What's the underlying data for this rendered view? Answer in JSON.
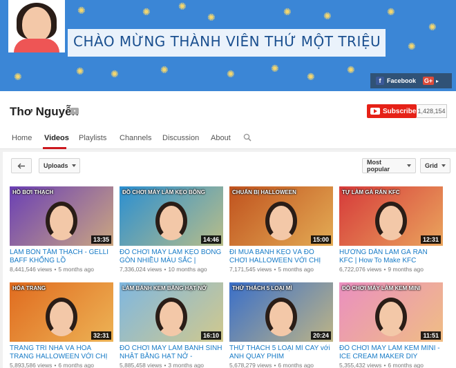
{
  "banner": {
    "tagline": "CHÀO MỪNG THÀNH VIÊN THỨ MỘT TRIỆU",
    "links": [
      {
        "label": "Facebook",
        "icon": "facebook-icon"
      },
      {
        "label": "",
        "icon": "google-plus-icon"
      }
    ]
  },
  "channel": {
    "name": "Thơ Nguyễn",
    "subscribe_label": "Subscribe",
    "subscriber_count": "1,428,154"
  },
  "tabs": [
    {
      "label": "Home",
      "active": false
    },
    {
      "label": "Videos",
      "active": true
    },
    {
      "label": "Playlists",
      "active": false
    },
    {
      "label": "Channels",
      "active": false
    },
    {
      "label": "Discussion",
      "active": false
    },
    {
      "label": "About",
      "active": false
    }
  ],
  "toolbar": {
    "uploads_label": "Uploads",
    "sort_label": "Most popular",
    "view_label": "Grid"
  },
  "videos": [
    {
      "title": "LÀM BỒN TẮM THẠCH - GELLI BAFF KHỔNG LỒ",
      "views": "8,441,546 views",
      "age": "5 months ago",
      "duration": "13:35",
      "thumb_caption": "HỒ BƠI THẠCH",
      "color": "#6a3fb5"
    },
    {
      "title": "ĐỒ CHƠI MÁY LÀM KẸO BÔNG GÒN NHIỀU MÀU SẮC | CANDY...",
      "views": "7,336,024 views",
      "age": "10 months ago",
      "duration": "14:46",
      "thumb_caption": "ĐỒ CHƠI MÁY LÀM KẸO BÔNG",
      "color": "#2b8fd1"
    },
    {
      "title": "ĐI MUA BÁNH KẸO VÀ ĐỒ CHƠI HALLOWEEN VỚI CHỊ THƠ...",
      "views": "7,171,545 views",
      "age": "5 months ago",
      "duration": "15:00",
      "thumb_caption": "CHUẨN BỊ HALLOWEEN",
      "color": "#c0521e"
    },
    {
      "title": "HƯỚNG DẪN LÀM GÀ RÁN KFC | How To Make KFC Chicken",
      "views": "6,722,076 views",
      "age": "9 months ago",
      "duration": "12:31",
      "thumb_caption": "TỰ LÀM GÀ RÁN KFC",
      "color": "#d63a3a"
    },
    {
      "title": "TRANG TRÍ NHÀ VÀ HÓA TRANG HALLOWEEN VỚI CHỊ THƠ...",
      "views": "5,893,586 views",
      "age": "6 months ago",
      "duration": "32:31",
      "thumb_caption": "HÓA TRANG",
      "color": "#e06b1f"
    },
    {
      "title": "ĐỒ CHƠI MÁY LÀM BÁNH SINH NHẬT BẰNG HẠT NỞ - ORBEEZ...",
      "views": "5,885,458 views",
      "age": "3 months ago",
      "duration": "16:10",
      "thumb_caption": "LÀM BÁNH KEM BẰNG HẠT NỞ",
      "color": "#7fb7e0"
    },
    {
      "title": "THỬ THÁCH 5 LOẠI MÌ CAY với ANH QUAY PHIM",
      "views": "5,678,279 views",
      "age": "6 months ago",
      "duration": "20:24",
      "thumb_caption": "THỬ THÁCH 5 LOẠI MÌ",
      "color": "#3a6fc9"
    },
    {
      "title": "ĐỒ CHƠI MÁY LÀM KEM MINI - ICE CREAM MAKER DIY",
      "views": "5,355,432 views",
      "age": "6 months ago",
      "duration": "11:51",
      "thumb_caption": "ĐỒ CHƠI MÁY LÀM KEM MINI",
      "color": "#ea8fc0"
    }
  ]
}
